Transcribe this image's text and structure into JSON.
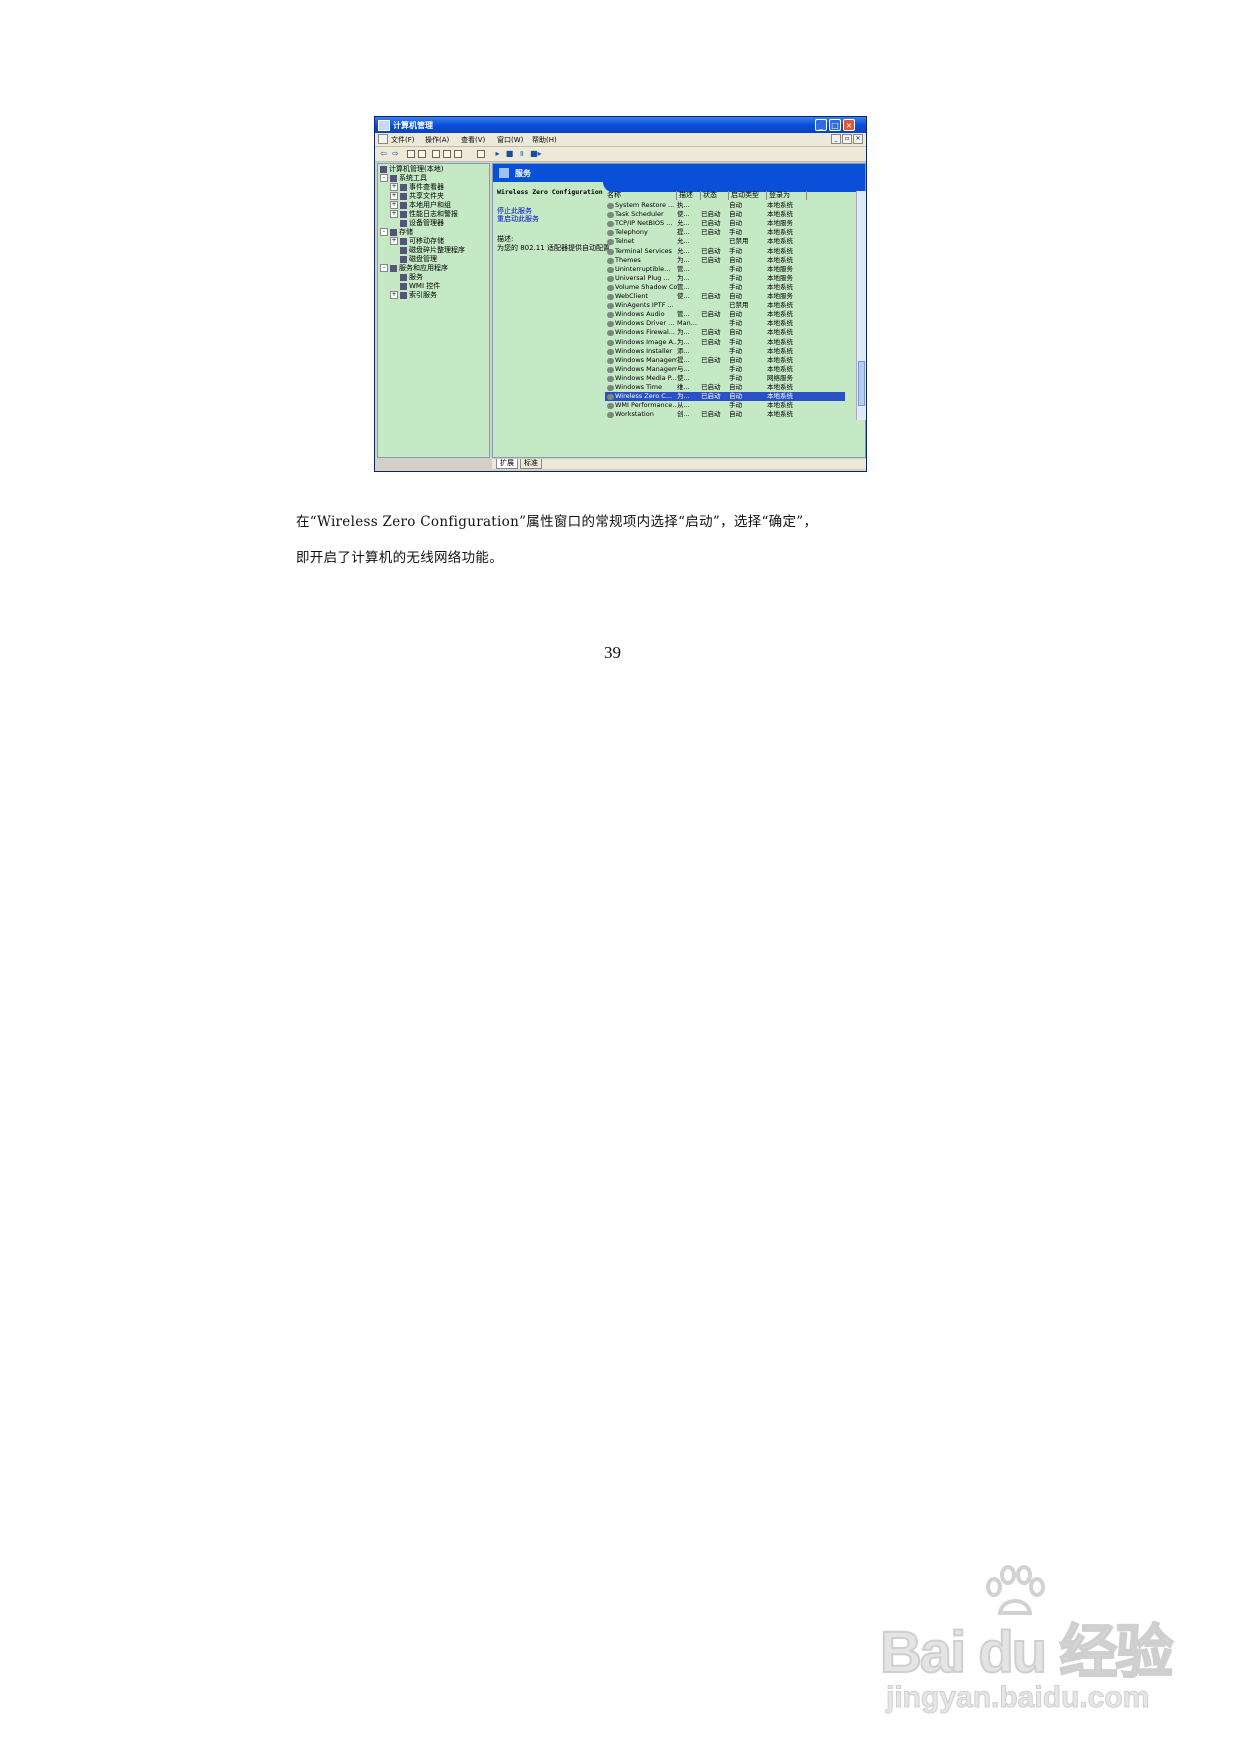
{
  "screenshot": {
    "title": "计算机管理",
    "menu": [
      "文件(F)",
      "操作(A)",
      "查看(V)",
      "窗口(W)",
      "帮助(H)"
    ],
    "tree": [
      "计算机管理(本地)",
      "系统工具",
      "事件查看器",
      "共享文件夹",
      "本地用户和组",
      "性能日志和警报",
      "设备管理器",
      "存储",
      "可移动存储",
      "磁盘碎片整理程序",
      "磁盘管理",
      "服务和应用程序",
      "服务",
      "WMI 控件",
      "索引服务"
    ],
    "services_header": "服务",
    "selected_service": "Wireless Zero Configuration",
    "stop_link": "停止此服务",
    "restart_link": "重启动此服务",
    "desc_label": "描述:",
    "desc_text": "为您的 802.11 适配器提供自动配置",
    "columns": [
      "名称",
      "描述",
      "状态",
      "启动类型",
      "登录为"
    ],
    "rows": [
      [
        "System Restore ...",
        "执...",
        "",
        "自动",
        "本地系统"
      ],
      [
        "Task Scheduler",
        "使...",
        "已启动",
        "自动",
        "本地系统"
      ],
      [
        "TCP/IP NetBIOS ...",
        "允...",
        "已启动",
        "自动",
        "本地服务"
      ],
      [
        "Telephony",
        "提...",
        "已启动",
        "手动",
        "本地系统"
      ],
      [
        "Telnet",
        "允...",
        "",
        "已禁用",
        "本地系统"
      ],
      [
        "Terminal Services",
        "允...",
        "已启动",
        "手动",
        "本地系统"
      ],
      [
        "Themes",
        "为...",
        "已启动",
        "自动",
        "本地系统"
      ],
      [
        "Uninterruptible...",
        "管...",
        "",
        "手动",
        "本地服务"
      ],
      [
        "Universal Plug ...",
        "为...",
        "",
        "手动",
        "本地服务"
      ],
      [
        "Volume Shadow Copy",
        "管...",
        "",
        "手动",
        "本地系统"
      ],
      [
        "WebClient",
        "使...",
        "已启动",
        "自动",
        "本地服务"
      ],
      [
        "WinAgents IPTF ...",
        "",
        "",
        "已禁用",
        "本地系统"
      ],
      [
        "Windows Audio",
        "管...",
        "已启动",
        "自动",
        "本地系统"
      ],
      [
        "Windows Driver ...",
        "Man...",
        "",
        "手动",
        "本地系统"
      ],
      [
        "Windows Firewal...",
        "为...",
        "已启动",
        "自动",
        "本地系统"
      ],
      [
        "Windows Image A...",
        "为...",
        "已启动",
        "手动",
        "本地系统"
      ],
      [
        "Windows Installer",
        "添...",
        "",
        "手动",
        "本地系统"
      ],
      [
        "Windows Managem...",
        "提...",
        "已启动",
        "自动",
        "本地系统"
      ],
      [
        "Windows Managem...",
        "与...",
        "",
        "手动",
        "本地系统"
      ],
      [
        "Windows Media P...",
        "使...",
        "",
        "手动",
        "网络服务"
      ],
      [
        "Windows Time",
        "维...",
        "已启动",
        "自动",
        "本地系统"
      ],
      [
        "Wireless Zero C...",
        "为...",
        "已启动",
        "自动",
        "本地系统"
      ],
      [
        "WMI Performance...",
        "从...",
        "",
        "手动",
        "本地系统"
      ],
      [
        "Workstation",
        "创...",
        "已启动",
        "自动",
        "本地系统"
      ]
    ],
    "selected_row_index": 21,
    "tabs": [
      "扩展",
      "标准"
    ]
  },
  "paragraph": {
    "line1": "在“Wireless Zero Configuration”属性窗口的常规项内选择“启动”，选择“确定”，",
    "line2": "即开启了计算机的无线网络功能。"
  },
  "page_number": "39",
  "watermark": {
    "brand": "Bai du 经验",
    "site": "jingyan.baidu.com"
  },
  "colors": {
    "titlebar": "#0a4fd7",
    "pane_bg": "#c5e8c5",
    "selection": "#2a50c8",
    "watermark": "#d8d8d8"
  }
}
